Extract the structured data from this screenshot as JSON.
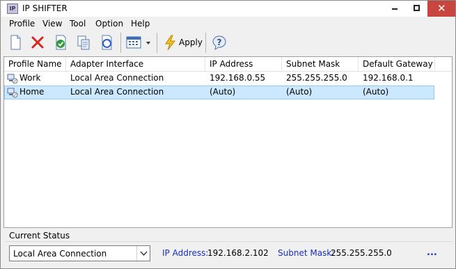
{
  "window": {
    "title": "IP SHIFTER",
    "app_icon_text": "IP"
  },
  "menu": {
    "items": [
      {
        "label": "Profile"
      },
      {
        "label": "View"
      },
      {
        "label": "Tool"
      },
      {
        "label": "Option"
      },
      {
        "label": "Help"
      }
    ]
  },
  "toolbar": {
    "buttons": [
      {
        "icon": "new-document-icon"
      },
      {
        "icon": "delete-x-icon"
      },
      {
        "icon": "apply-check-icon"
      },
      {
        "icon": "copy-icon"
      },
      {
        "icon": "refresh-icon"
      },
      {
        "icon": "view-grid-icon"
      },
      {
        "icon": "apply-lightning-icon"
      },
      {
        "icon": "help-icon"
      }
    ],
    "apply_label": "Apply"
  },
  "list": {
    "columns": [
      "Profile Name",
      "Adapter Interface",
      "IP Address",
      "Subnet Mask",
      "Default Gateway"
    ],
    "rows": [
      {
        "profile": "Work",
        "adapter": "Local Area Connection",
        "ip": "192.168.0.55",
        "subnet": "255.255.255.0",
        "gateway": "192.168.0.1",
        "selected": false
      },
      {
        "profile": "Home",
        "adapter": "Local Area Connection",
        "ip": "(Auto)",
        "subnet": "(Auto)",
        "gateway": "(Auto)",
        "selected": true
      }
    ]
  },
  "status": {
    "title": "Current Status",
    "adapter_selected": "Local Area Connection",
    "ip_label": "IP Address:",
    "ip_value": "192.168.2.102",
    "subnet_label": "Subnet Mask:",
    "subnet_value": "255.255.255.0",
    "more": "..."
  },
  "colors": {
    "close_button": "#c7463d",
    "selection": "#cce8ff",
    "info_label": "#1a2fbf"
  }
}
